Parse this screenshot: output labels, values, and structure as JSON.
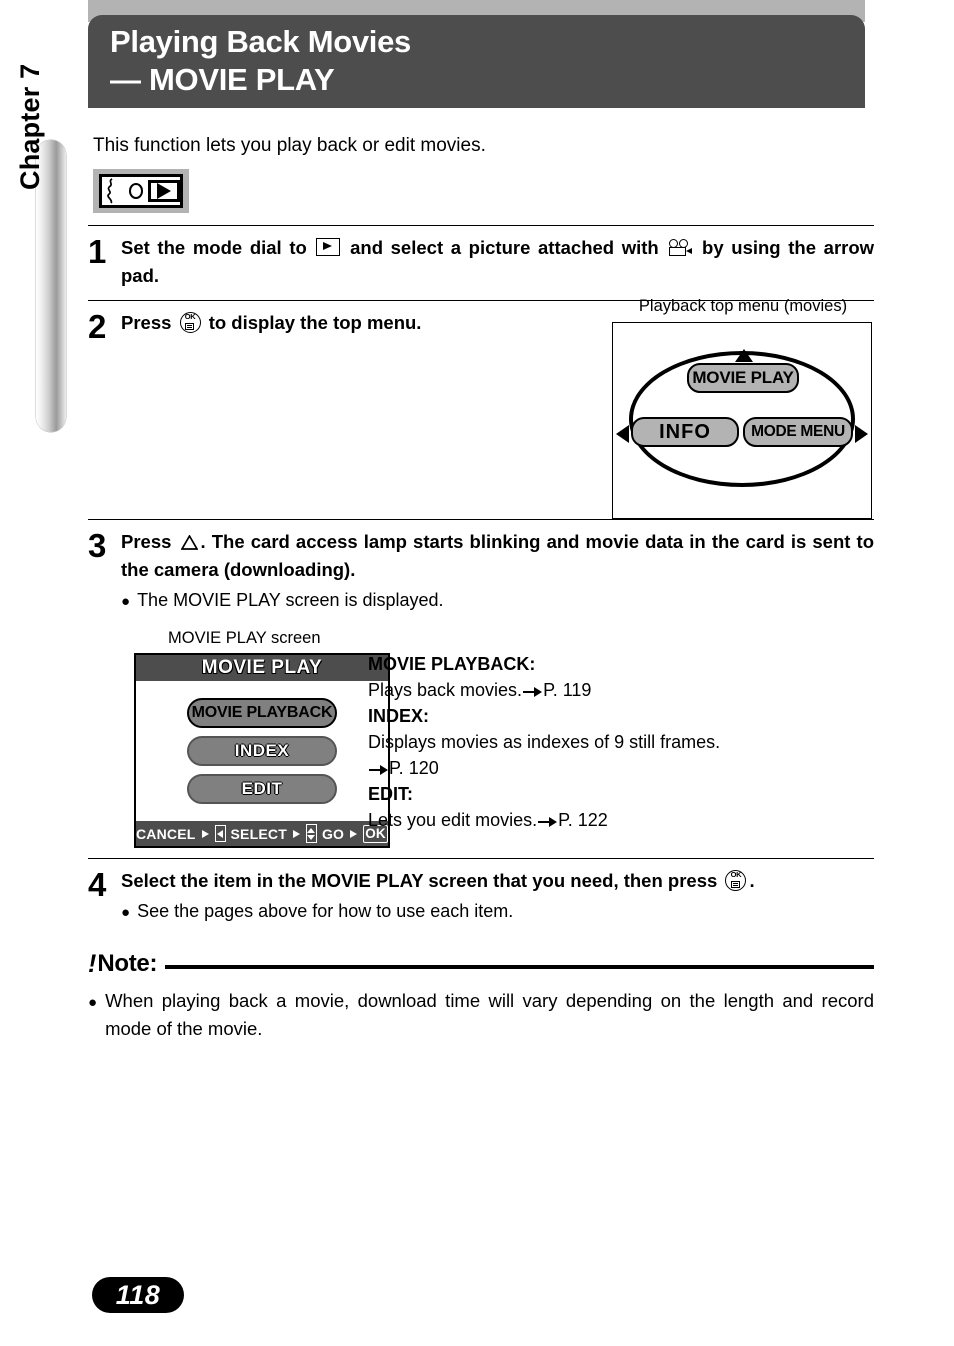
{
  "chapter": {
    "label": "Chapter 7"
  },
  "header": {
    "line1": "Playing Back Movies",
    "line2": "— MOVIE PLAY"
  },
  "intro": "This function lets you play back or edit movies.",
  "mode_icon": {
    "name": "mode-dial-playback-icon"
  },
  "steps": [
    {
      "number": "1",
      "text_a": "Set the mode dial to",
      "icon_a": "playback-icon",
      "text_b": "and select a picture attached with",
      "icon_b": "movie-camera-icon",
      "text_c": "by using the arrow pad."
    },
    {
      "number": "2",
      "text_a": "Press",
      "icon_a": "ok-button-icon",
      "text_b": "to display the top menu."
    },
    {
      "number": "3",
      "text_a": "Press",
      "icon_a": "up-arrow-icon",
      "text_b": ". The card access lamp starts blinking and movie data in the card is sent to the camera (downloading).",
      "bullet": "The MOVIE PLAY screen is displayed."
    },
    {
      "number": "4",
      "text_a": "Select the item in the MOVIE PLAY screen that you need, then press",
      "icon_a": "ok-button-icon",
      "text_b": ".",
      "bullet": "See the pages above for how to use each item."
    }
  ],
  "top_menu_diagram": {
    "caption": "Playback top menu (movies)",
    "items": [
      "MOVIE PLAY",
      "INFO",
      "MODE MENU"
    ],
    "arrows": [
      "up",
      "left",
      "right"
    ]
  },
  "lcd_screen": {
    "caption": "MOVIE PLAY screen",
    "title": "MOVIE PLAY",
    "items": [
      {
        "label": "MOVIE PLAYBACK",
        "selected": true
      },
      {
        "label": "INDEX",
        "selected": false
      },
      {
        "label": "EDIT",
        "selected": false
      }
    ],
    "footer": {
      "cancel": "CANCEL",
      "select": "SELECT",
      "go": "GO",
      "ok_key": "OK"
    }
  },
  "descriptions": [
    {
      "term": "MOVIE PLAYBACK:",
      "body": "Plays back movies.",
      "page": "P. 119"
    },
    {
      "term": "INDEX:",
      "body": "Displays movies as indexes of 9 still frames.",
      "page": "P. 120"
    },
    {
      "term": "EDIT:",
      "body": "Lets you edit movies.",
      "page": "P. 122"
    }
  ],
  "note": {
    "bang": "!",
    "title": "Note:",
    "bullet": "When playing back a movie, download time will vary depending on the length and record mode of the movie."
  },
  "page_number": "118",
  "colors": {
    "header_bg": "#4d4d4d",
    "band_gray": "#b3b3b3",
    "button_gray": "#808080",
    "page_pill": "#000000"
  }
}
